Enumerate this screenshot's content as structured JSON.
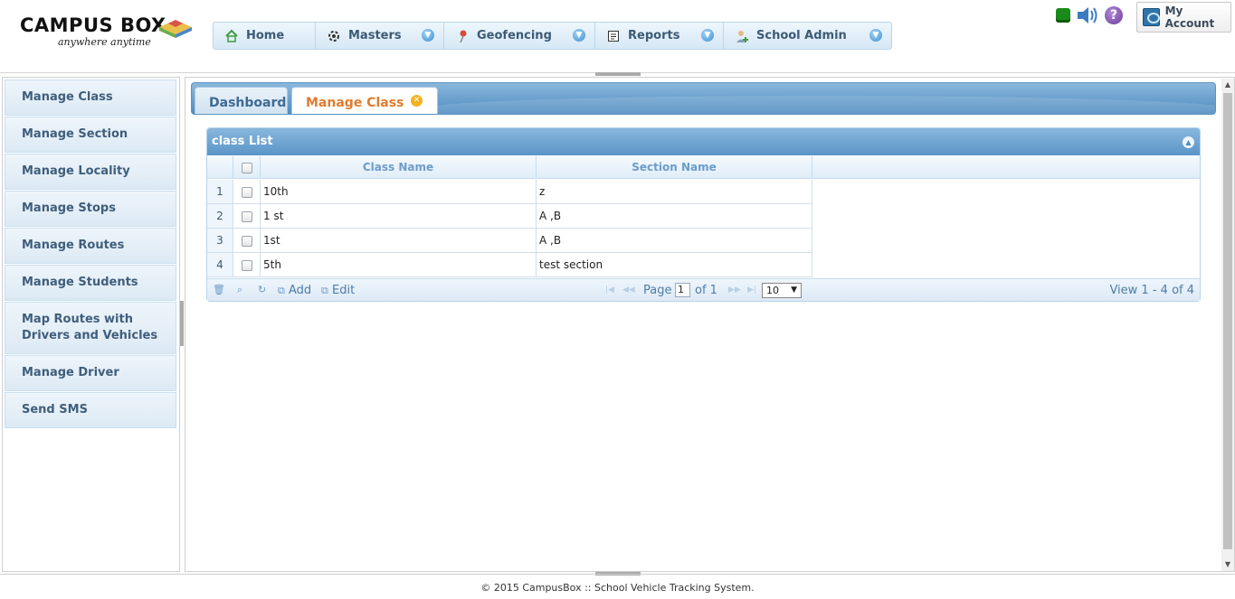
{
  "brand": {
    "name": "CAMPUS BOX",
    "tagline": "anywhere anytime"
  },
  "menu": [
    {
      "label": "Home",
      "icon": "home-icon",
      "has_dropdown": false
    },
    {
      "label": "Masters",
      "icon": "gear-icon",
      "has_dropdown": true
    },
    {
      "label": "Geofencing",
      "icon": "map-pin-icon",
      "has_dropdown": true
    },
    {
      "label": "Reports",
      "icon": "report-icon",
      "has_dropdown": true
    },
    {
      "label": "School Admin",
      "icon": "admin-user-icon",
      "has_dropdown": true
    }
  ],
  "top_icons": {
    "help": "?"
  },
  "account": {
    "label": "My Account"
  },
  "sidebar": {
    "items": [
      {
        "label": "Manage Class"
      },
      {
        "label": "Manage Section"
      },
      {
        "label": "Manage Locality"
      },
      {
        "label": "Manage Stops"
      },
      {
        "label": "Manage Routes"
      },
      {
        "label": "Manage Students"
      },
      {
        "label": "Map Routes with Drivers and Vehicles"
      },
      {
        "label": "Manage Driver"
      },
      {
        "label": "Send SMS"
      }
    ]
  },
  "tabs": [
    {
      "label": "Dashboard",
      "active": false
    },
    {
      "label": "Manage Class",
      "active": true
    }
  ],
  "grid": {
    "caption": "class List",
    "columns": [
      "Class Name",
      "Section Name"
    ],
    "rows": [
      {
        "num": "1",
        "class_name": "10th",
        "section_name": "z"
      },
      {
        "num": "2",
        "class_name": "1 st",
        "section_name": "A ,B"
      },
      {
        "num": "3",
        "class_name": "1st",
        "section_name": "A ,B"
      },
      {
        "num": "4",
        "class_name": "5th",
        "section_name": "test section"
      }
    ],
    "pager": {
      "add_label": "Add",
      "edit_label": "Edit",
      "page_label": "Page",
      "page_value": "1",
      "of_label": "of 1",
      "rows_per_page": "10",
      "view_text": "View 1 - 4 of 4"
    }
  },
  "footer": {
    "text": "© 2015 CampusBox :: School Vehicle Tracking System."
  },
  "colors": {
    "accent": "#5a95c8",
    "active_tab_text": "#e07b2e",
    "sidebar_text": "#3f5e7b"
  }
}
